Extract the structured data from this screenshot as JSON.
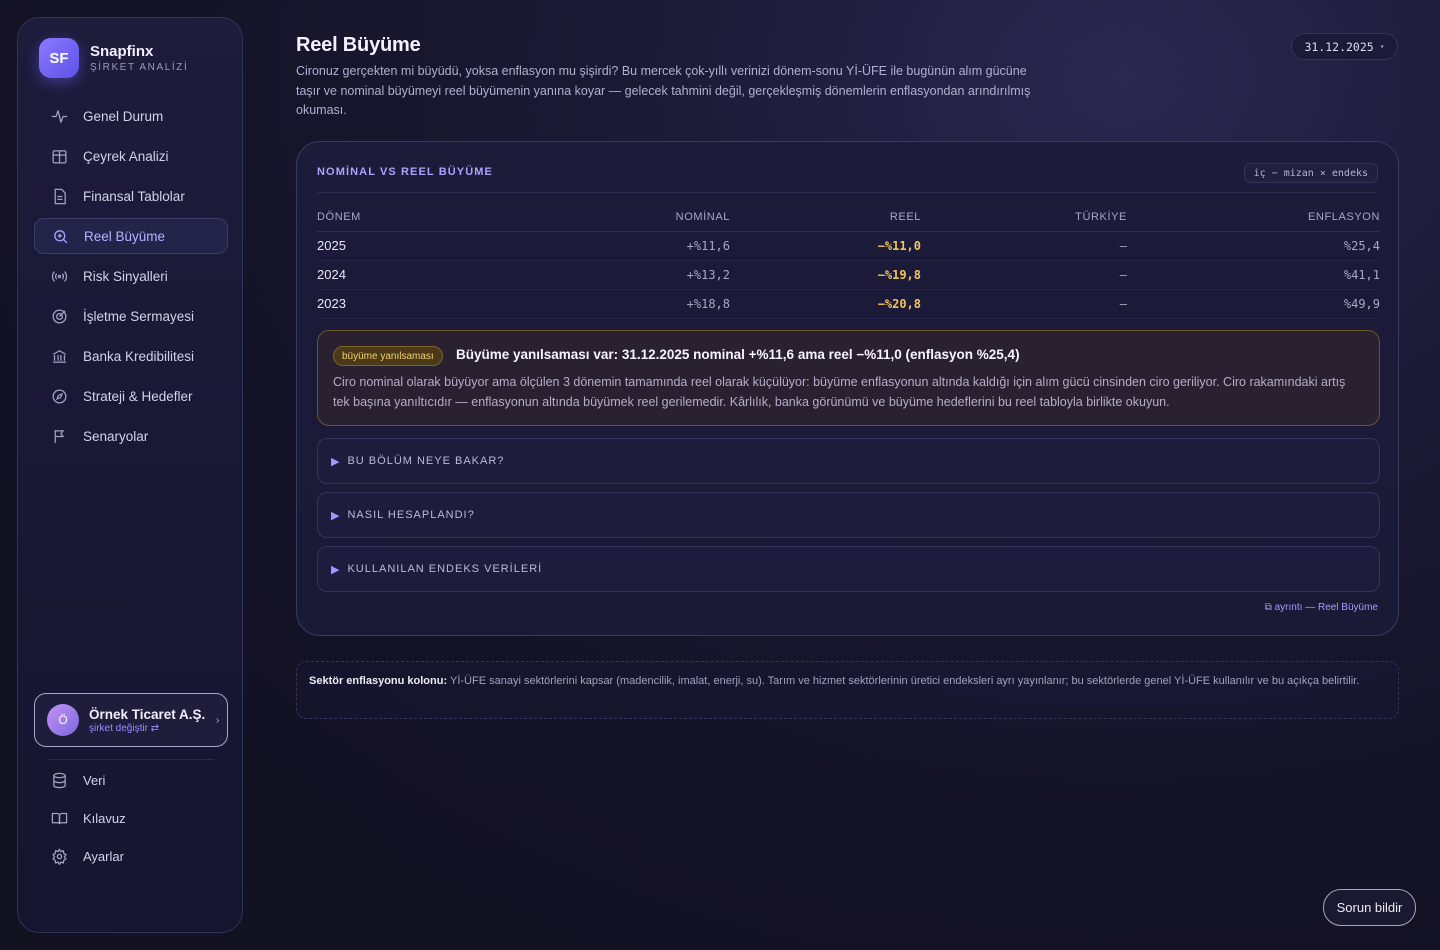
{
  "brand": {
    "initials": "SF",
    "name": "Snapfinx",
    "subtitle": "ŞİRKET ANALİZİ"
  },
  "sidebar": {
    "items": [
      {
        "label": "Genel Durum",
        "icon": "activity-icon"
      },
      {
        "label": "Çeyrek Analizi",
        "icon": "calendar-grid-icon"
      },
      {
        "label": "Finansal Tablolar",
        "icon": "document-icon"
      },
      {
        "label": "Reel Büyüme",
        "icon": "search-zoom-icon",
        "active": true
      },
      {
        "label": "Risk Sinyalleri",
        "icon": "signal-icon"
      },
      {
        "label": "İşletme Sermayesi",
        "icon": "target-icon"
      },
      {
        "label": "Banka Kredibilitesi",
        "icon": "bank-icon"
      },
      {
        "label": "Strateji & Hedefler",
        "icon": "compass-icon"
      },
      {
        "label": "Senaryolar",
        "icon": "flag-icon"
      }
    ],
    "company": {
      "avatar": "Ö",
      "name": "Örnek Ticaret A.Ş.",
      "switch_label": "şirket değiştir ⇄"
    },
    "bottom_items": [
      {
        "label": "Veri",
        "icon": "database-icon"
      },
      {
        "label": "Kılavuz",
        "icon": "book-icon"
      },
      {
        "label": "Ayarlar",
        "icon": "gear-icon"
      }
    ]
  },
  "header": {
    "title": "Reel Büyüme",
    "description": "Cironuz gerçekten mi büyüdü, yoksa enflasyon mu şişirdi? Bu mercek çok-yıllı verinizi dönem-sonu Yİ-ÜFE ile bugünün alım gücüne taşır ve nominal büyümeyi reel büyümenin yanına koyar — gelecek tahmini değil, gerçekleşmiş dönemlerin enflasyondan arındırılmış okuması.",
    "date": "31.12.2025"
  },
  "card": {
    "title": "NOMİNAL VS REEL BÜYÜME",
    "tag": "iç − mizan × endeks",
    "columns": [
      "DÖNEM",
      "NOMİNAL",
      "REEL",
      "TÜRKİYE",
      "ENFLASYON"
    ],
    "rows": [
      {
        "donem": "2025",
        "nominal": "+%11,6",
        "reel": "−%11,0",
        "turkiye": "—",
        "enflasyon": "%25,4"
      },
      {
        "donem": "2024",
        "nominal": "+%13,2",
        "reel": "−%19,8",
        "turkiye": "—",
        "enflasyon": "%41,1"
      },
      {
        "donem": "2023",
        "nominal": "+%18,8",
        "reel": "−%20,8",
        "turkiye": "—",
        "enflasyon": "%49,9"
      }
    ],
    "alert": {
      "badge": "büyüme yanılsaması",
      "title": "Büyüme yanılsaması var: 31.12.2025 nominal +%11,6 ama reel −%11,0 (enflasyon %25,4)",
      "body": "Ciro nominal olarak büyüyor ama ölçülen 3 dönemin tamamında reel olarak küçülüyor: büyüme enflasyonun altında kaldığı için alım gücü cinsinden ciro geriliyor. Ciro rakamındaki artış tek başına yanıltıcıdır — enflasyonun altında büyümek reel gerilemedir. Kârlılık, banka görünümü ve büyüme hedeflerini bu reel tabloyla birlikte okuyun."
    },
    "accordions": [
      "BU BÖLÜM NEYE BAKAR?",
      "NASIL HESAPLANDI?",
      "KULLANILAN ENDEKS VERİLERİ"
    ],
    "detail_link": "⧉ ayrıntı — Reel Büyüme"
  },
  "note": {
    "label": "Sektör enflasyonu kolonu:",
    "text": " Yİ-ÜFE sanayi sektörlerini kapsar (madencilik, imalat, enerji, su). Tarım ve hizmet sektörlerinin üretici endeksleri ayrı yayınlanır; bu sektörlerde genel Yİ-ÜFE kullanılır ve bu açıkça belirtilir."
  },
  "report_button": "Sorun bildir",
  "colors": {
    "accent": "#8a7bff",
    "warning": "#f3c55b",
    "background": "#141326"
  }
}
